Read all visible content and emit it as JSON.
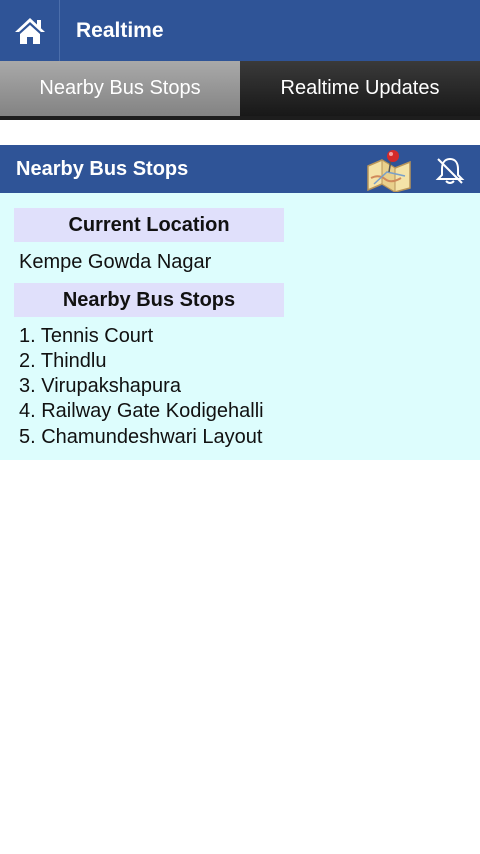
{
  "app": {
    "title": "Realtime"
  },
  "tabs": [
    {
      "label": "Nearby Bus Stops",
      "active": true
    },
    {
      "label": "Realtime Updates",
      "active": false
    }
  ],
  "section": {
    "title": "Nearby Bus Stops"
  },
  "current_location": {
    "heading": "Current Location",
    "value": "Kempe Gowda Nagar"
  },
  "nearby": {
    "heading": "Nearby Bus Stops",
    "stops": [
      "1. Tennis Court",
      "2. Thindlu",
      "3. Virupakshapura",
      "4. Railway Gate Kodigehalli",
      "5. Chamundeshwari Layout"
    ]
  },
  "colors": {
    "primary": "#2f5497",
    "content_bg": "#ddfdfd",
    "label_bg": "#e0e0fb"
  },
  "icons": {
    "home": "home-icon",
    "map": "map-icon",
    "bell": "bell-off-icon"
  }
}
